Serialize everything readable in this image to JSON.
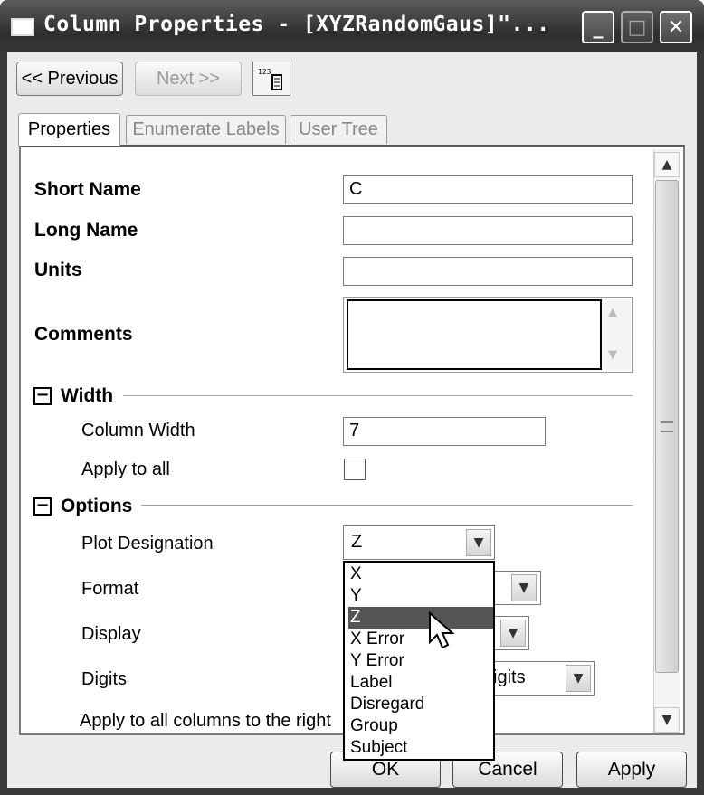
{
  "window": {
    "title": "Column Properties - [XYZRandomGaus]\"...",
    "controls": {
      "minimize": "_",
      "maximize": "□",
      "close": "✕"
    }
  },
  "toolbar": {
    "previous_label": "<< Previous",
    "next_label": "Next >>",
    "tool_icon_text": "123"
  },
  "tabs": [
    {
      "label": "Properties",
      "active": true
    },
    {
      "label": "Enumerate Labels",
      "active": false
    },
    {
      "label": "User Tree",
      "active": false
    }
  ],
  "properties": {
    "short_name": {
      "label": "Short Name",
      "value": "C"
    },
    "long_name": {
      "label": "Long Name",
      "value": ""
    },
    "units": {
      "label": "Units",
      "value": ""
    },
    "comments": {
      "label": "Comments",
      "value": ""
    }
  },
  "width_section": {
    "header": "Width",
    "column_width": {
      "label": "Column Width",
      "value": "7"
    },
    "apply_to_all": {
      "label": "Apply to all",
      "checked": false
    }
  },
  "options_section": {
    "header": "Options",
    "plot_designation": {
      "label": "Plot Designation",
      "value": "Z"
    },
    "format": {
      "label": "Format"
    },
    "display": {
      "label": "Display"
    },
    "digits": {
      "label": "Digits",
      "value_visible_part": "igits"
    },
    "apply_right": {
      "label": "Apply to all columns to the right"
    }
  },
  "dropdown": {
    "options": [
      "X",
      "Y",
      "Z",
      "X Error",
      "Y Error",
      "Label",
      "Disregard",
      "Group",
      "Subject"
    ],
    "highlighted": "Z"
  },
  "buttons": {
    "ok": "OK",
    "cancel": "Cancel",
    "apply": "Apply"
  },
  "colors": {
    "titlebar": "#3a3a3a",
    "highlight": "#555555",
    "client_bg": "#ebebeb"
  },
  "icons": [
    "window-app-icon",
    "minimize-icon",
    "maximize-icon",
    "close-icon",
    "scroll-up-icon",
    "scroll-down-icon",
    "collapse-icon",
    "chevron-down-icon",
    "mouse-cursor-icon"
  ]
}
